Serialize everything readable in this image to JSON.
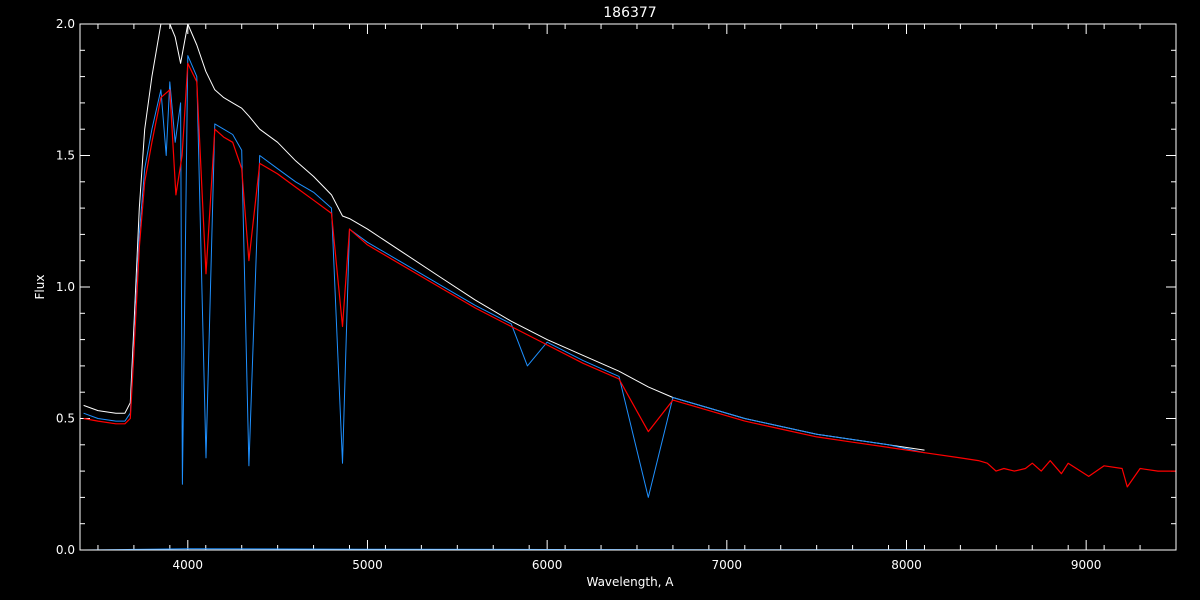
{
  "chart_data": {
    "type": "line",
    "title": "186377",
    "xlabel": "Wavelength, A",
    "ylabel": "Flux",
    "xlim": [
      3400,
      9500
    ],
    "ylim": [
      0.0,
      2.0
    ],
    "xticks": [
      4000,
      5000,
      6000,
      7000,
      8000,
      9000
    ],
    "yticks": [
      0.0,
      0.5,
      1.0,
      1.5,
      2.0
    ],
    "xtick_labels": [
      "4000",
      "5000",
      "6000",
      "7000",
      "8000",
      "9000"
    ],
    "ytick_labels": [
      "0.0",
      "0.5",
      "1.0",
      "1.5",
      "2.0"
    ],
    "grid": false,
    "background": "#000000",
    "series": [
      {
        "color": "#ffffff",
        "x": [
          3420,
          3500,
          3600,
          3650,
          3680,
          3700,
          3730,
          3760,
          3800,
          3850,
          3900,
          3930,
          3960,
          4000,
          4050,
          4100,
          4150,
          4200,
          4250,
          4300,
          4340,
          4400,
          4500,
          4600,
          4700,
          4800,
          4861,
          4900,
          5000,
          5200,
          5400,
          5600,
          5800,
          6000,
          6200,
          6400,
          6563,
          6700,
          6900,
          7100,
          7300,
          7500,
          7700,
          7900,
          8100
        ],
        "y": [
          0.55,
          0.53,
          0.52,
          0.52,
          0.56,
          0.85,
          1.3,
          1.6,
          1.8,
          2.0,
          2.0,
          1.95,
          1.85,
          2.0,
          1.92,
          1.82,
          1.75,
          1.72,
          1.7,
          1.68,
          1.65,
          1.6,
          1.55,
          1.48,
          1.42,
          1.35,
          1.27,
          1.26,
          1.22,
          1.13,
          1.04,
          0.95,
          0.87,
          0.8,
          0.74,
          0.68,
          0.62,
          0.58,
          0.54,
          0.5,
          0.47,
          0.44,
          0.42,
          0.4,
          0.38
        ]
      },
      {
        "color": "#1e90ff",
        "x": [
          3420,
          3500,
          3600,
          3650,
          3680,
          3700,
          3730,
          3760,
          3800,
          3850,
          3880,
          3900,
          3930,
          3960,
          3970,
          4000,
          4050,
          4101,
          4150,
          4200,
          4250,
          4300,
          4340,
          4400,
          4500,
          4600,
          4700,
          4800,
          4861,
          4900,
          5000,
          5200,
          5400,
          5600,
          5800,
          5890,
          6000,
          6200,
          6400,
          6563,
          6700,
          6900,
          7100,
          7300,
          7500,
          7700,
          7900,
          8100
        ],
        "y": [
          0.52,
          0.5,
          0.49,
          0.49,
          0.52,
          0.78,
          1.2,
          1.45,
          1.6,
          1.75,
          1.5,
          1.78,
          1.55,
          1.7,
          0.25,
          1.88,
          1.8,
          0.35,
          1.62,
          1.6,
          1.58,
          1.52,
          0.32,
          1.5,
          1.45,
          1.4,
          1.36,
          1.3,
          0.33,
          1.22,
          1.17,
          1.09,
          1.01,
          0.93,
          0.86,
          0.7,
          0.79,
          0.72,
          0.66,
          0.2,
          0.58,
          0.54,
          0.5,
          0.47,
          0.44,
          0.42,
          0.4,
          0.37
        ]
      },
      {
        "color": "#ff0000",
        "x": [
          3420,
          3500,
          3600,
          3650,
          3680,
          3700,
          3730,
          3760,
          3800,
          3850,
          3900,
          3934,
          3968,
          4000,
          4050,
          4101,
          4150,
          4200,
          4250,
          4300,
          4340,
          4400,
          4500,
          4600,
          4700,
          4800,
          4861,
          4900,
          5000,
          5200,
          5400,
          5600,
          5800,
          6000,
          6200,
          6400,
          6563,
          6700,
          6900,
          7100,
          7300,
          7500,
          7700,
          7900,
          8100,
          8300,
          8400,
          8450,
          8498,
          8542,
          8600,
          8662,
          8700,
          8750,
          8800,
          8862,
          8900,
          9014,
          9100,
          9200,
          9229,
          9300,
          9400,
          9500
        ],
        "y": [
          0.5,
          0.49,
          0.48,
          0.48,
          0.5,
          0.75,
          1.15,
          1.4,
          1.55,
          1.72,
          1.75,
          1.35,
          1.5,
          1.85,
          1.78,
          1.05,
          1.6,
          1.57,
          1.55,
          1.45,
          1.1,
          1.47,
          1.43,
          1.38,
          1.33,
          1.28,
          0.85,
          1.22,
          1.16,
          1.08,
          1.0,
          0.92,
          0.85,
          0.78,
          0.71,
          0.65,
          0.45,
          0.57,
          0.53,
          0.49,
          0.46,
          0.43,
          0.41,
          0.39,
          0.37,
          0.35,
          0.34,
          0.33,
          0.3,
          0.31,
          0.3,
          0.31,
          0.33,
          0.3,
          0.34,
          0.29,
          0.33,
          0.28,
          0.32,
          0.31,
          0.24,
          0.31,
          0.3,
          0.3
        ]
      },
      {
        "color": "#1e90ff",
        "x": [
          3420,
          4000,
          5000,
          6000,
          7000,
          8000,
          8100
        ],
        "y": [
          0.0,
          0.005,
          0.003,
          0.002,
          0.001,
          0.001,
          0.001
        ]
      }
    ]
  }
}
